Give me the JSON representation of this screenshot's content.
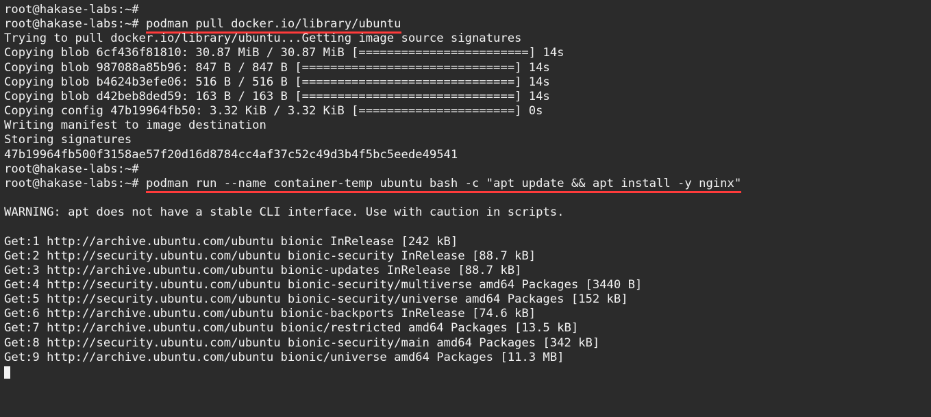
{
  "prompt": "root@hakase-labs:~#",
  "cmd1": "podman pull docker.io/library/ubuntu",
  "cmd2": "podman run --name container-temp ubuntu bash -c \"apt update && apt install -y nginx\"",
  "l01": "Trying to pull docker.io/library/ubuntu...Getting image source signatures",
  "l02": "Copying blob 6cf436f81810: 30.87 MiB / 30.87 MiB [========================] 14s",
  "l03": "Copying blob 987088a85b96: 847 B / 847 B [==============================] 14s",
  "l04": "Copying blob b4624b3efe06: 516 B / 516 B [==============================] 14s",
  "l05": "Copying blob d42beb8ded59: 163 B / 163 B [==============================] 14s",
  "l06": "Copying config 47b19964fb50: 3.32 KiB / 3.32 KiB [======================] 0s",
  "l07": "Writing manifest to image destination",
  "l08": "Storing signatures",
  "l09": "47b19964fb500f3158ae57f20d16d8784cc4af37c52c49d3b4f5bc5eede49541",
  "l10": "",
  "l11": "WARNING: apt does not have a stable CLI interface. Use with caution in scripts.",
  "l12": "",
  "l13": "Get:1 http://archive.ubuntu.com/ubuntu bionic InRelease [242 kB]",
  "l14": "Get:2 http://security.ubuntu.com/ubuntu bionic-security InRelease [88.7 kB]",
  "l15": "Get:3 http://archive.ubuntu.com/ubuntu bionic-updates InRelease [88.7 kB]",
  "l16": "Get:4 http://security.ubuntu.com/ubuntu bionic-security/multiverse amd64 Packages [3440 B]",
  "l17": "Get:5 http://security.ubuntu.com/ubuntu bionic-security/universe amd64 Packages [152 kB]",
  "l18": "Get:6 http://archive.ubuntu.com/ubuntu bionic-backports InRelease [74.6 kB]",
  "l19": "Get:7 http://archive.ubuntu.com/ubuntu bionic/restricted amd64 Packages [13.5 kB]",
  "l20": "Get:8 http://security.ubuntu.com/ubuntu bionic-security/main amd64 Packages [342 kB]",
  "l21": "Get:9 http://archive.ubuntu.com/ubuntu bionic/universe amd64 Packages [11.3 MB]"
}
